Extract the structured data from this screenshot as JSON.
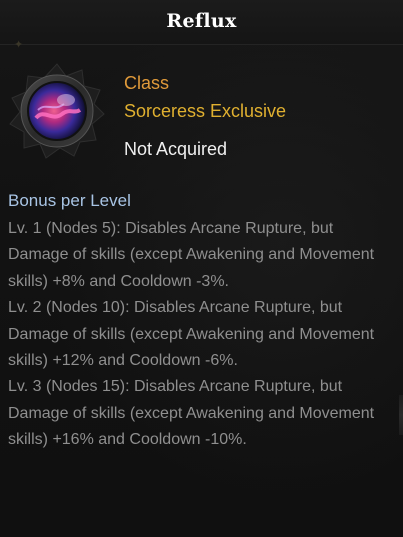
{
  "tooltip": {
    "title": "Reflux",
    "icon": "engraving-reflux-icon",
    "class_label": "Class",
    "exclusivity": "Sorceress Exclusive",
    "status": "Not Acquired",
    "bonus_heading": "Bonus per Level",
    "levels": [
      {
        "text": "Lv. 1 (Nodes 5): Disables Arcane Rupture, but Damage of skills (except Awakening and Movement skills) +8% and Cooldown -3%."
      },
      {
        "text": "Lv. 2 (Nodes 10): Disables Arcane Rupture, but Damage of skills (except Awakening and Movement skills) +12% and Cooldown -6%."
      },
      {
        "text": "Lv. 3 (Nodes 15): Disables Arcane Rupture, but Damage of skills (except Awakening and Movement skills) +16% and Cooldown -10%."
      }
    ],
    "colors": {
      "class": "#e09a3a",
      "exclusivity": "#e0b030",
      "status": "#f0f0f0",
      "heading": "#a8c4e4",
      "effect_text": "#8f8f8f"
    }
  }
}
